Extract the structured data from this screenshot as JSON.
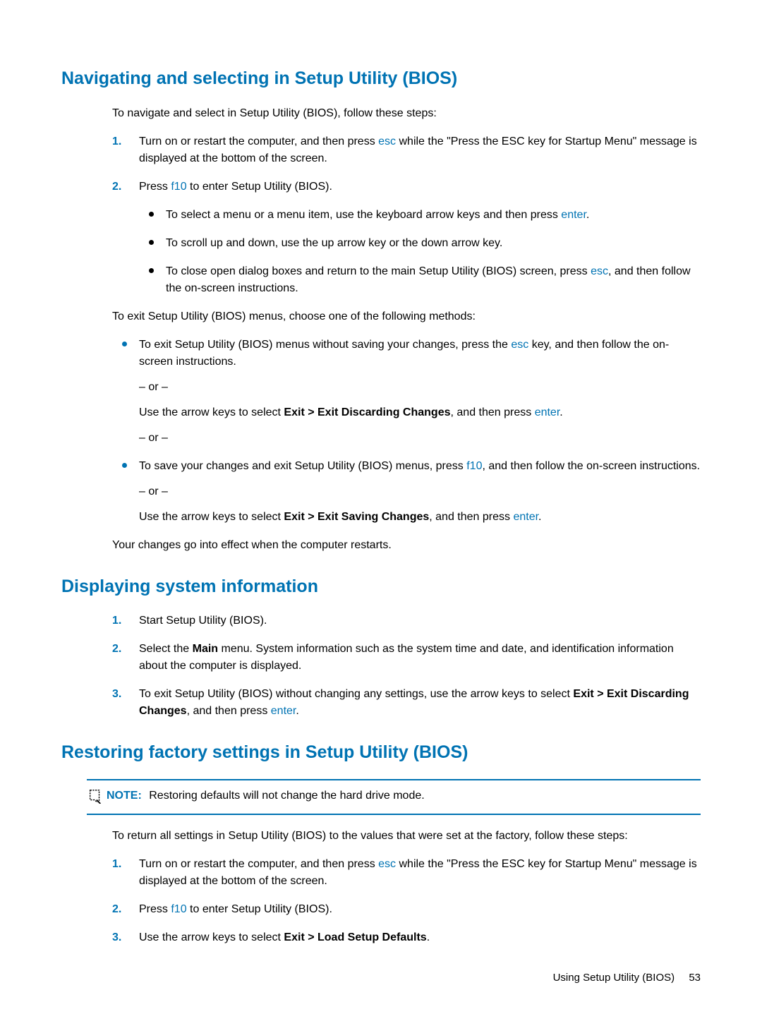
{
  "headings": {
    "h_nav": "Navigating and selecting in Setup Utility (BIOS)",
    "h_disp": "Displaying system information",
    "h_rest": "Restoring factory settings in Setup Utility (BIOS)"
  },
  "keys": {
    "esc": "esc",
    "f10": "f10",
    "enter": "enter"
  },
  "nav": {
    "intro": "To navigate and select in Setup Utility (BIOS), follow these steps:",
    "step1_a": "Turn on or restart the computer, and then press ",
    "step1_b": " while the \"Press the ESC key for Startup Menu\" message is displayed at the bottom of the screen.",
    "step2_a": "Press ",
    "step2_b": " to enter Setup Utility (BIOS).",
    "bullet1_a": "To select a menu or a menu item, use the keyboard arrow keys and then press ",
    "bullet1_b": ".",
    "bullet2": "To scroll up and down, use the up arrow key or the down arrow key.",
    "bullet3_a": "To close open dialog boxes and return to the main Setup Utility (BIOS) screen, press ",
    "bullet3_b": ", and then follow the on-screen instructions.",
    "exit_intro": "To exit Setup Utility (BIOS) menus, choose one of the following methods:",
    "exit_b1_a": "To exit Setup Utility (BIOS) menus without saving your changes, press the ",
    "exit_b1_b": " key, and then follow the on-screen instructions.",
    "or": "– or –",
    "exit_b1_c": "Use the arrow keys to select ",
    "exit_b1_menu": "Exit > Exit Discarding Changes",
    "exit_b1_d": ", and then press ",
    "exit_b1_e": ".",
    "exit_b2_a": "To save your changes and exit Setup Utility (BIOS) menus, press ",
    "exit_b2_b": ", and then follow the on-screen instructions.",
    "exit_b2_c": "Use the arrow keys to select ",
    "exit_b2_menu": "Exit > Exit Saving Changes",
    "exit_b2_d": ", and then press ",
    "exit_b2_e": ".",
    "outro": "Your changes go into effect when the computer restarts."
  },
  "disp": {
    "step1": "Start Setup Utility (BIOS).",
    "step2_a": "Select the ",
    "step2_main": "Main",
    "step2_b": " menu. System information such as the system time and date, and identification information about the computer is displayed.",
    "step3_a": "To exit Setup Utility (BIOS) without changing any settings, use the arrow keys to select ",
    "step3_menu": "Exit > Exit Discarding Changes",
    "step3_b": ", and then press ",
    "step3_c": "."
  },
  "rest": {
    "note_label": "NOTE:",
    "note_text": "Restoring defaults will not change the hard drive mode.",
    "intro": "To return all settings in Setup Utility (BIOS) to the values that were set at the factory, follow these steps:",
    "step1_a": "Turn on or restart the computer, and then press ",
    "step1_b": " while the \"Press the ESC key for Startup Menu\" message is displayed at the bottom of the screen.",
    "step2_a": "Press ",
    "step2_b": " to enter Setup Utility (BIOS).",
    "step3_a": "Use the arrow keys to select ",
    "step3_menu": "Exit > Load Setup Defaults",
    "step3_b": "."
  },
  "footer": {
    "label": "Using Setup Utility (BIOS)",
    "page": "53"
  },
  "numbers": {
    "n1": "1.",
    "n2": "2.",
    "n3": "3."
  }
}
